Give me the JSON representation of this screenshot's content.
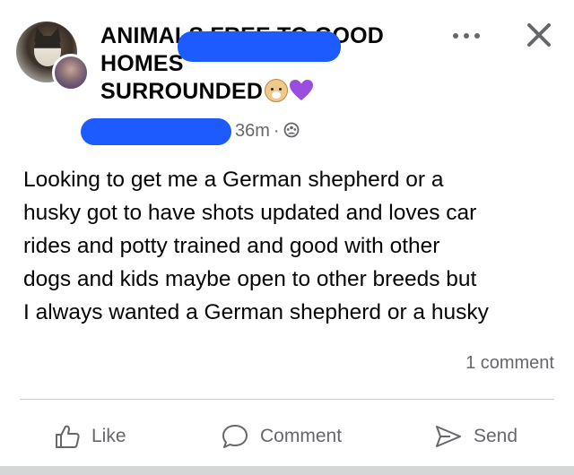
{
  "header": {
    "group_name_lines": [
      "ANIMALS FREE TO GOOD",
      "HOMES",
      "SURROUNDED"
    ],
    "time_ago": "36m",
    "separator": "·",
    "audience_icon": "group-audience-icon",
    "more_icon": "more-options-icon",
    "close_icon": "close-icon"
  },
  "post": {
    "text_lines": [
      "Looking to get me a German shepherd or a",
      "husky got to have shots updated and loves car",
      "rides and potty trained and good with other",
      "dogs and kids maybe open to other breeds but",
      "I always wanted a German shepherd or a husky"
    ]
  },
  "stats": {
    "comment_count": "1 comment"
  },
  "actions": {
    "like_label": "Like",
    "comment_label": "Comment",
    "send_label": "Send"
  },
  "colors": {
    "redaction": "#1e5bff",
    "secondary_text": "#65676b",
    "divider": "#ced0d4",
    "heart_emoji": "#9b4de0"
  }
}
